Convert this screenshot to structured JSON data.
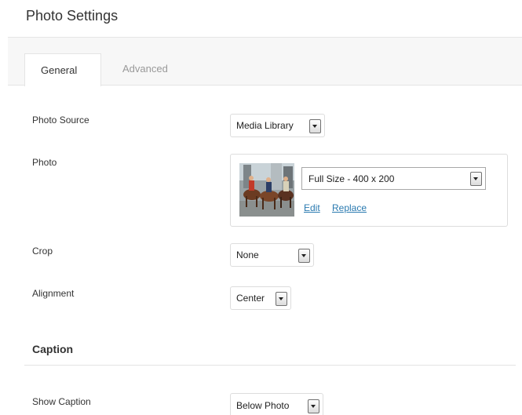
{
  "header": {
    "title": "Photo Settings"
  },
  "tabs": [
    {
      "label": "General",
      "active": true
    },
    {
      "label": "Advanced",
      "active": false
    }
  ],
  "fields": {
    "photo_source": {
      "label": "Photo Source",
      "value": "Media Library"
    },
    "photo": {
      "label": "Photo",
      "size_value": "Full Size - 400 x 200",
      "edit_label": "Edit",
      "replace_label": "Replace"
    },
    "crop": {
      "label": "Crop",
      "value": "None"
    },
    "alignment": {
      "label": "Alignment",
      "value": "Center"
    }
  },
  "caption_section": {
    "title": "Caption",
    "show_caption": {
      "label": "Show Caption",
      "value": "Below Photo"
    }
  },
  "colors": {
    "link": "#2a7ab0",
    "tabbar_bg": "#f7f7f7",
    "border": "#dddddd"
  }
}
